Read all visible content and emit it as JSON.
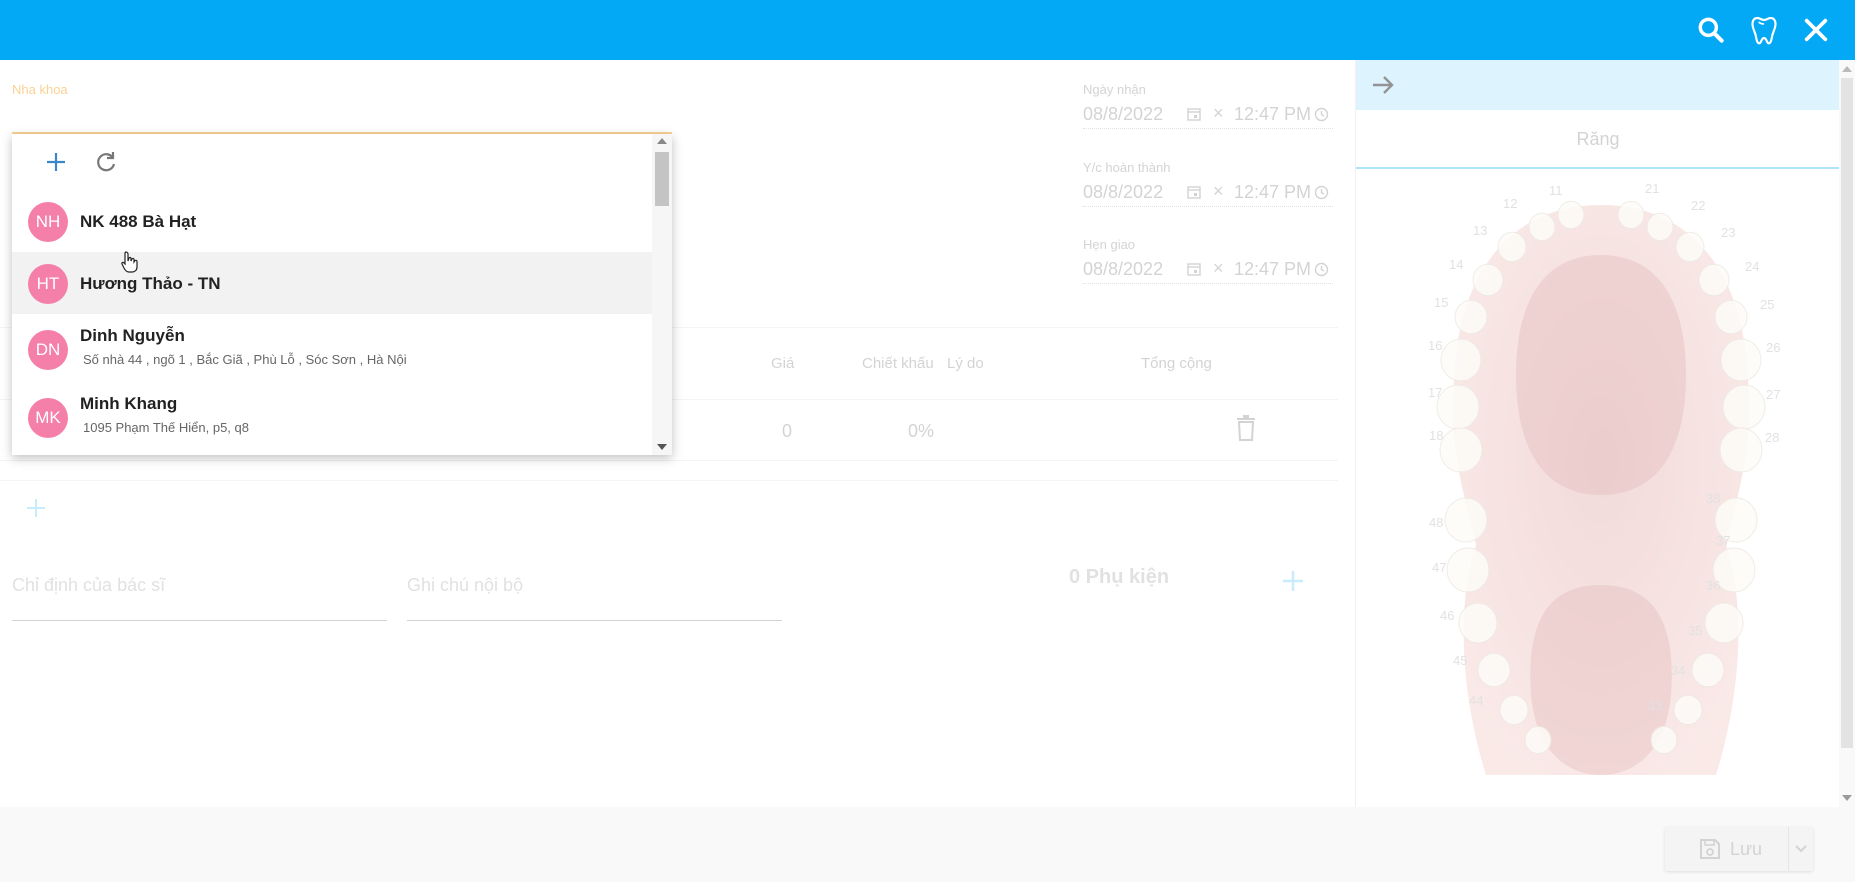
{
  "topbar": {
    "color": "#03a9f4",
    "icons": [
      "search-icon",
      "tooth-icon",
      "close-icon"
    ]
  },
  "order": {
    "lab_label": "Nha khoa",
    "dates": [
      {
        "label": "Ngày nhận",
        "date": "08/8/2022",
        "time": "12:47 PM"
      },
      {
        "label": "Y/c hoàn thành",
        "date": "08/8/2022",
        "time": "12:47 PM"
      },
      {
        "label": "Hẹn giao",
        "date": "08/8/2022",
        "time": "12:47 PM"
      }
    ],
    "table": {
      "headers": {
        "price": "Giá",
        "discount": "Chiết khấu",
        "reason": "Lý do",
        "total": "Tổng cộng"
      },
      "row": {
        "price": "0",
        "discount": "0%"
      }
    },
    "doctor_note": "Chỉ định của bác sĩ",
    "internal_note": "Ghi chú nội bộ",
    "accessories": "0 Phụ kiện"
  },
  "dropdown": {
    "items": [
      {
        "initials": "NH",
        "name": "NK 488 Bà Hạt",
        "address": ""
      },
      {
        "initials": "HT",
        "name": "Hương Thảo - TN",
        "address": ""
      },
      {
        "initials": "DN",
        "name": "Dinh Nguyễn",
        "address": "Số nhà 44 , ngõ 1 , Bắc Giã , Phù Lỗ , Sóc Sơn , Hà Nội"
      },
      {
        "initials": "MK",
        "name": "Minh Khang",
        "address": "1095 Phạm Thế Hiển, p5, q8"
      }
    ],
    "avatar_color": "#f47fa8"
  },
  "teeth_panel": {
    "tab": "Răng",
    "numbers": {
      "upper": [
        "11",
        "12",
        "13",
        "14",
        "15",
        "16",
        "17",
        "18",
        "21",
        "22",
        "23",
        "24",
        "25",
        "26",
        "27",
        "28"
      ],
      "lower": [
        "48",
        "47",
        "46",
        "45",
        "44",
        "38",
        "37",
        "36",
        "35",
        "34",
        "33"
      ]
    }
  },
  "footer": {
    "save_label": "Lưu"
  }
}
